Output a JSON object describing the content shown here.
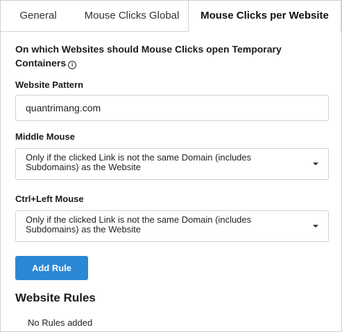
{
  "tabs": [
    {
      "label": "General"
    },
    {
      "label": "Mouse Clicks Global"
    },
    {
      "label": "Mouse Clicks per Website",
      "active": true
    }
  ],
  "section": {
    "heading": "On which Websites should Mouse Clicks open Temporary Containers",
    "info_icon": "info-icon"
  },
  "website_pattern": {
    "label": "Website Pattern",
    "value": "quantrimang.com"
  },
  "middle_mouse": {
    "label": "Middle Mouse",
    "selected": "Only if the clicked Link is not the same Domain (includes Subdomains) as the Website"
  },
  "ctrl_left_mouse": {
    "label": "Ctrl+Left Mouse",
    "selected": "Only if the clicked Link is not the same Domain (includes Subdomains) as the Website"
  },
  "add_rule_label": "Add Rule",
  "rules": {
    "title": "Website Rules",
    "empty_text": "No Rules added"
  },
  "colors": {
    "accent": "#2a87d6",
    "border": "#d0d0d0"
  }
}
